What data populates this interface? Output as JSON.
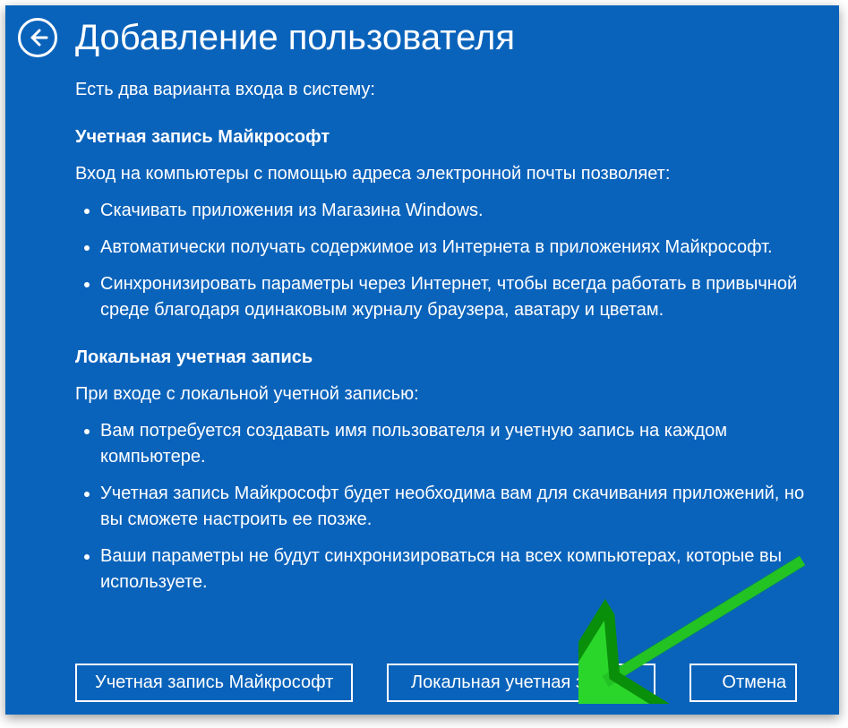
{
  "title": "Добавление пользователя",
  "intro": "Есть два варианта входа в систему:",
  "ms": {
    "heading": "Учетная запись Майкрософт",
    "lead": "Вход на компьютеры с помощью адреса электронной почты позволяет:",
    "bullets": [
      "Скачивать приложения из Магазина Windows.",
      "Автоматически получать содержимое из Интернета в приложениях Майкрософт.",
      "Синхронизировать параметры через Интернет, чтобы всегда работать в привычной среде благодаря одинаковым журналу браузера, аватару и цветам."
    ]
  },
  "local": {
    "heading": "Локальная учетная запись",
    "lead": "При входе с локальной учетной записью:",
    "bullets": [
      "Вам потребуется создавать имя пользователя и учетную запись на каждом компьютере.",
      "Учетная запись Майкрософт будет необходима вам для скачивания приложений, но вы сможете настроить ее позже.",
      "Ваши параметры не будут синхронизироваться на всех компьютерах, которые вы используете."
    ]
  },
  "buttons": {
    "ms": "Учетная запись Майкрософт",
    "local": "Локальная учетная запись",
    "cancel": "Отмена"
  }
}
